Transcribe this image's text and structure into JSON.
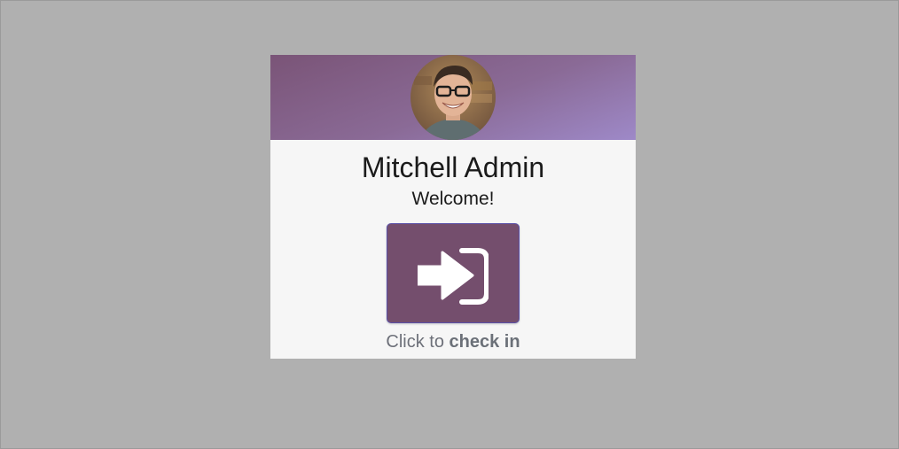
{
  "kiosk": {
    "employee_name": "Mitchell Admin",
    "greeting": "Welcome!",
    "caption_prefix": "Click to ",
    "caption_action": "check in",
    "checkin_icon": "sign-in-icon",
    "colors": {
      "background": "#b0b0b0",
      "card": "#f6f6f6",
      "header_start": "#7a5477",
      "header_end": "#9e89c8",
      "button": "#744e6d",
      "caption": "#6d7079"
    }
  }
}
